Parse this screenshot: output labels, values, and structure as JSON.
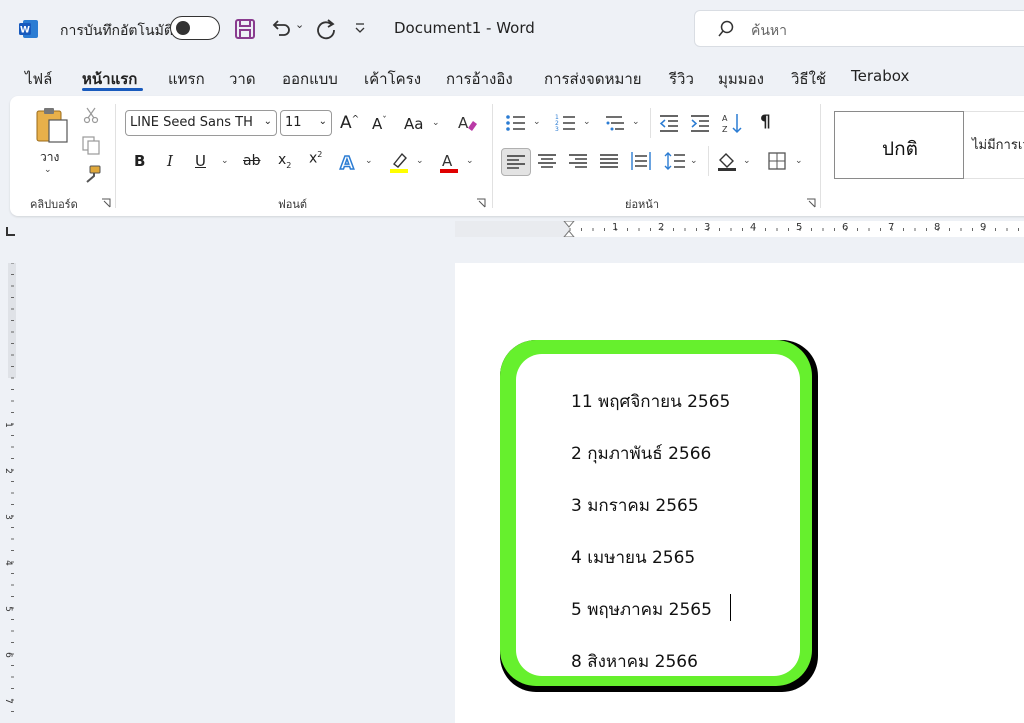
{
  "titlebar": {
    "autosave_label": "การบันทึกอัตโนมัติ",
    "document_title": "Document1  -  Word",
    "search_placeholder": "ค้นหา"
  },
  "tabs": [
    {
      "label": "ไฟล์"
    },
    {
      "label": "หน้าแรก",
      "active": true
    },
    {
      "label": "แทรก"
    },
    {
      "label": "วาด"
    },
    {
      "label": "ออกแบบ"
    },
    {
      "label": "เค้าโครง"
    },
    {
      "label": "การอ้างอิง"
    },
    {
      "label": "การส่งจดหมาย"
    },
    {
      "label": "รีวิว"
    },
    {
      "label": "มุมมอง"
    },
    {
      "label": "วิธีใช้"
    },
    {
      "label": "Terabox"
    }
  ],
  "ribbon": {
    "clipboard": {
      "paste_label": "วาง",
      "group_label": "คลิปบอร์ด"
    },
    "font": {
      "font_name": "LINE Seed Sans TH",
      "font_size": "11",
      "change_case_label": "Aa",
      "bold": "B",
      "italic": "I",
      "underline": "U",
      "strikethrough": "ab",
      "group_label": "ฟอนต์"
    },
    "paragraph": {
      "group_label": "ย่อหน้า"
    },
    "styles": {
      "normal_label": "ปกติ",
      "no_spacing_label": "ไม่มีการเว้นระยะ"
    }
  },
  "ruler": {
    "horizontal_numbers": [
      "1",
      "2",
      "3",
      "4",
      "5",
      "6",
      "7",
      "8",
      "9"
    ],
    "vertical_numbers": [
      "1",
      "2",
      "3",
      "4",
      "5",
      "6",
      "7"
    ]
  },
  "document": {
    "lines": [
      "11 พฤศจิกายน 2565",
      "2 กุมภาพันธ์ 2566",
      "3 มกราคม 2565",
      "4 เมษายน 2565",
      "5 พฤษภาคม 2565",
      "8 สิงหาคม 2566"
    ],
    "frame_color": "#66f02d"
  },
  "colors": {
    "accent": "#185abd",
    "highlight_yellow": "#ffff00",
    "font_color_red": "#e00000",
    "save_icon_purple": "#8a3c8f"
  }
}
